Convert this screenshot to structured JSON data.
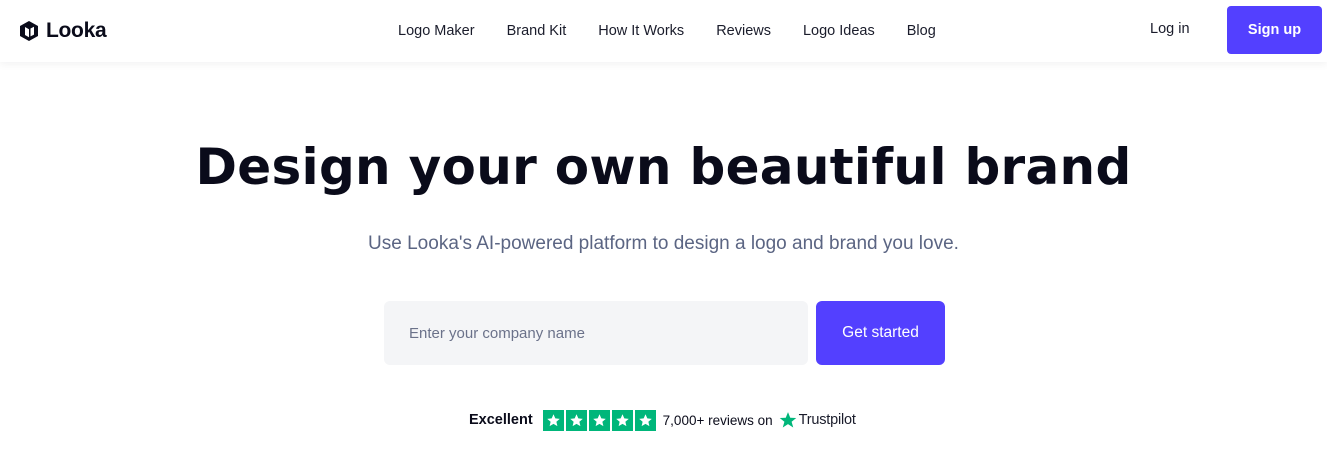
{
  "header": {
    "brand": "Looka",
    "nav": [
      {
        "label": "Logo Maker"
      },
      {
        "label": "Brand Kit"
      },
      {
        "label": "How It Works"
      },
      {
        "label": "Reviews"
      },
      {
        "label": "Logo Ideas"
      },
      {
        "label": "Blog"
      }
    ],
    "login_label": "Log in",
    "signup_label": "Sign up"
  },
  "hero": {
    "title": "Design your own beautiful brand",
    "subtitle": "Use Looka's AI-powered platform to design a logo and brand you love.",
    "input_placeholder": "Enter your company name",
    "input_value": "",
    "cta_label": "Get started"
  },
  "trust": {
    "rating_label": "Excellent",
    "stars": 5,
    "reviews_text": "7,000+ reviews on",
    "provider": "Trustpilot"
  },
  "icons": {
    "brand_logo": "looka-logo-icon",
    "rating_star": "star-icon",
    "provider_star": "trustpilot-star-icon"
  },
  "colors": {
    "accent": "#5340ff",
    "text": "#0a0b1a",
    "muted": "#5b6583",
    "input_bg": "#f4f5f7",
    "trust_green": "#00b67a"
  }
}
